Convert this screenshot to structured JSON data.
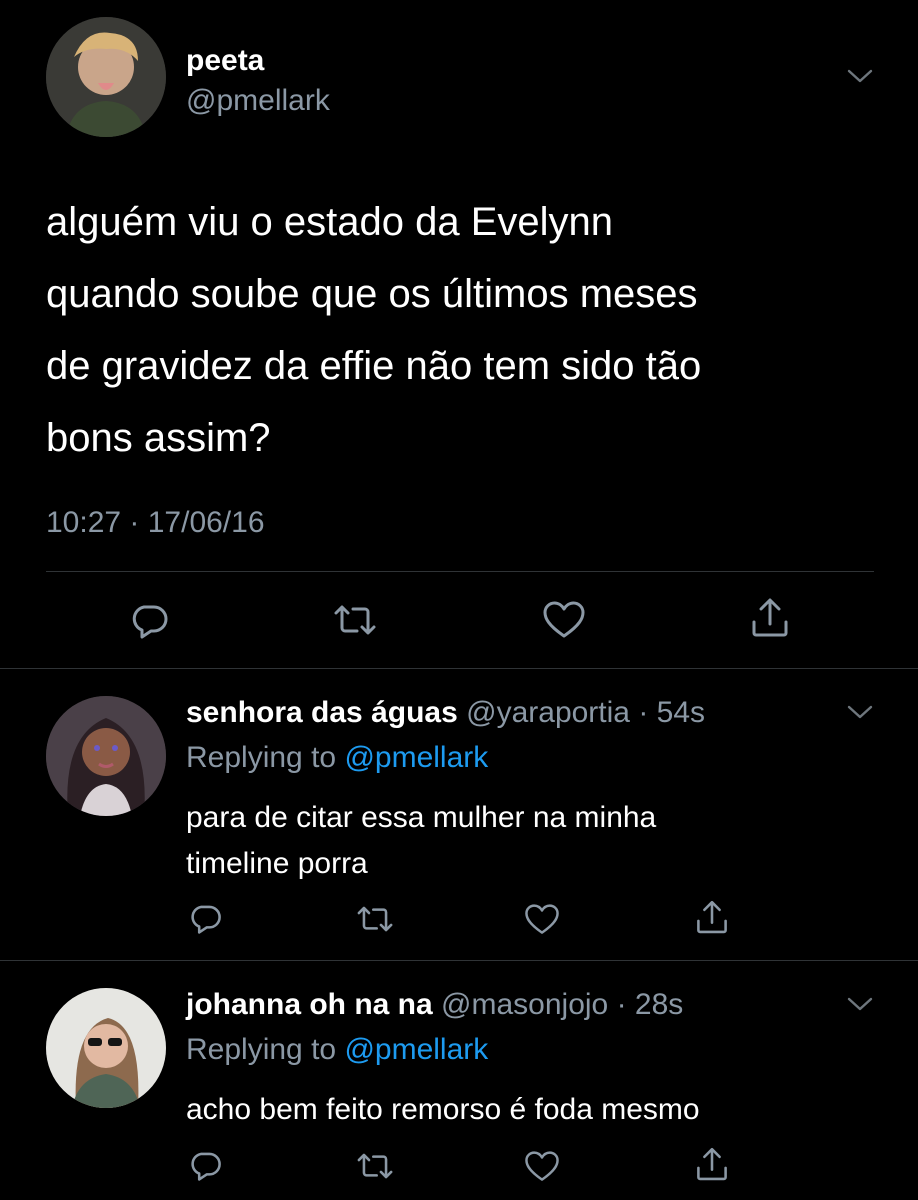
{
  "main_tweet": {
    "display_name": "peeta",
    "handle": "@pmellark",
    "text_lines": [
      "alguém viu o estado da Evelynn",
      "quando soube que os últimos meses",
      "de gravidez da effie não tem sido tão",
      "bons assim?"
    ],
    "timestamp": "10:27 · 17/06/16"
  },
  "replies": [
    {
      "display_name": "senhora das águas",
      "handle": "@yaraportia",
      "time": "54s",
      "replying_prefix": "Replying to",
      "replying_to": "@pmellark",
      "text_lines": [
        "para de citar essa mulher na minha",
        "timeline porra"
      ]
    },
    {
      "display_name": "johanna oh na na",
      "handle": "@masonjojo",
      "time": "28s",
      "replying_prefix": "Replying to",
      "replying_to": "@pmellark",
      "text_lines": [
        "acho bem feito remorso é foda mesmo"
      ]
    }
  ],
  "icons": {
    "reply": "reply-icon",
    "retweet": "retweet-icon",
    "like": "heart-icon",
    "share": "share-icon",
    "more": "chevron-down-icon"
  },
  "colors": {
    "background": "#000000",
    "primary_text": "#ffffff",
    "secondary_text": "#8b98a5",
    "link": "#1d9bf0",
    "divider": "#2f3336"
  }
}
